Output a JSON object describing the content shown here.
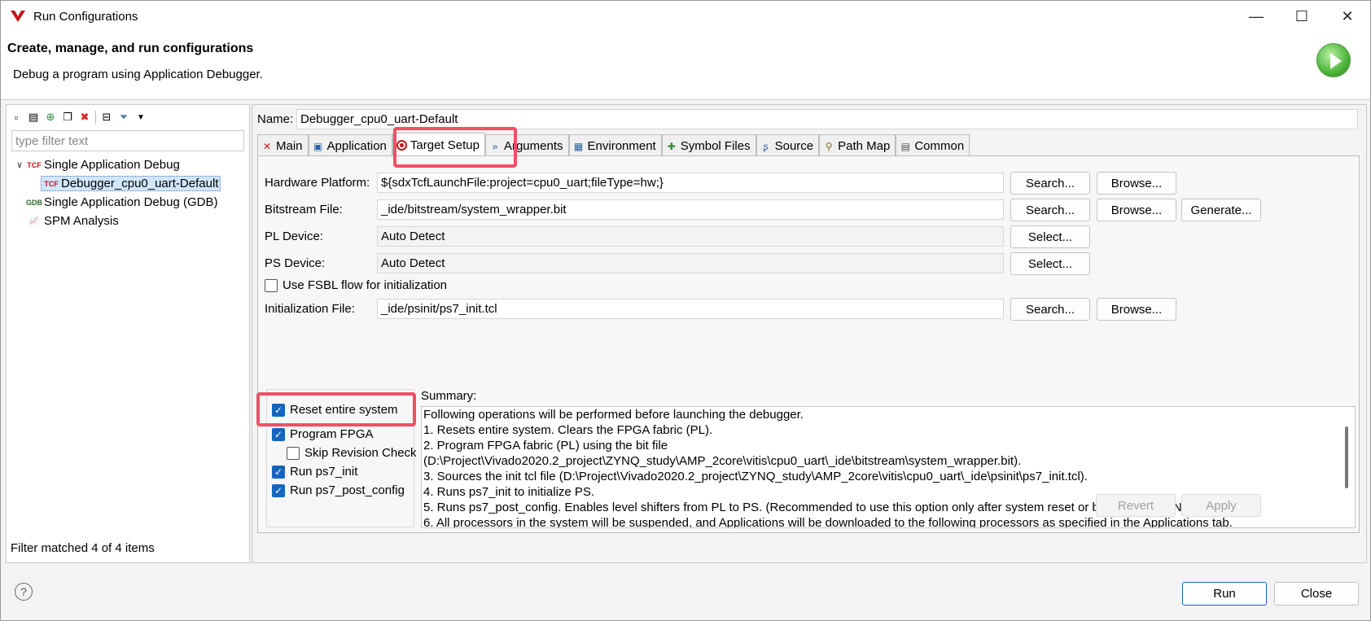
{
  "window": {
    "title": "Run Configurations",
    "controls": {
      "minimize": "—",
      "maximize": "☐",
      "close": "✕"
    }
  },
  "header": {
    "title": "Create, manage, and run configurations",
    "subtitle": "Debug a program using Application Debugger."
  },
  "left": {
    "filter_placeholder": "type filter text",
    "tree": [
      {
        "label": "Single Application Debug",
        "icon": "tcf-launch-icon"
      },
      {
        "label": "Debugger_cpu0_uart-Default",
        "icon": "tcf-launch-icon"
      },
      {
        "label": "Single Application Debug (GDB)",
        "icon": "gdb-launch-icon"
      },
      {
        "label": "SPM Analysis",
        "icon": "spm-chart-icon"
      }
    ],
    "status": "Filter matched 4 of 4 items"
  },
  "config": {
    "name_label": "Name:",
    "name_value": "Debugger_cpu0_uart-Default",
    "tabs": [
      "Main",
      "Application",
      "Target Setup",
      "Arguments",
      "Environment",
      "Symbol Files",
      "Source",
      "Path Map",
      "Common"
    ],
    "active_tab": "Target Setup"
  },
  "target": {
    "hw_label": "Hardware Platform:",
    "hw_value": "${sdxTcfLaunchFile:project=cpu0_uart;fileType=hw;}",
    "bit_label": "Bitstream File:",
    "bit_value": "_ide/bitstream/system_wrapper.bit",
    "pl_label": "PL Device:",
    "pl_value": "Auto Detect",
    "ps_label": "PS Device:",
    "ps_value": "Auto Detect",
    "fsbl_label": "Use FSBL flow for initialization",
    "init_label": "Initialization File:",
    "init_value": "_ide/psinit/ps7_init.tcl",
    "search": "Search...",
    "browse": "Browse...",
    "generate": "Generate...",
    "select": "Select..."
  },
  "options": {
    "reset": "Reset entire system",
    "program": "Program FPGA",
    "skip": "Skip Revision Check",
    "ps7init": "Run ps7_init",
    "ps7post": "Run ps7_post_config"
  },
  "summary": {
    "label": "Summary:",
    "lines": [
      "Following operations will be performed before launching the debugger.",
      "1. Resets entire system. Clears the FPGA fabric (PL).",
      "2. Program FPGA fabric (PL) using the bit file",
      "(D:\\Project\\Vivado2020.2_project\\ZYNQ_study\\AMP_2core\\vitis\\cpu0_uart\\_ide\\bitstream\\system_wrapper.bit).",
      "3. Sources the init tcl file (D:\\Project\\Vivado2020.2_project\\ZYNQ_study\\AMP_2core\\vitis\\cpu0_uart\\_ide\\psinit\\ps7_init.tcl).",
      "4. Runs ps7_init to initialize PS.",
      "5. Runs ps7_post_config. Enables level shifters from PL to PS. (Recommended to use this option only after system reset or board power ON).",
      "6. All processors in the system will be suspended, and Applications will be downloaded to the following processors as specified in the Applications tab."
    ]
  },
  "actions": {
    "revert": "Revert",
    "apply": "Apply",
    "run": "Run",
    "close": "Close",
    "help": "?"
  },
  "colors": {
    "highlight": "#ef5066",
    "checkbox": "#1565c0",
    "accent_red": "#c3151a"
  }
}
